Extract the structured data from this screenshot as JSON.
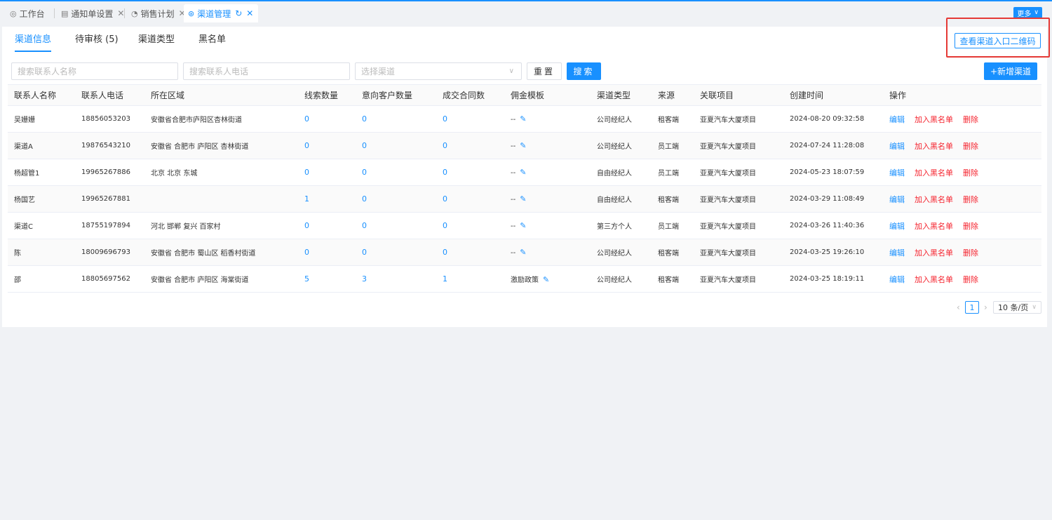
{
  "tabs": [
    {
      "label": "工作台",
      "icon": "dashboard-icon",
      "closable": false,
      "active": false
    },
    {
      "label": "通知单设置",
      "icon": "document-icon",
      "closable": true,
      "active": false
    },
    {
      "label": "销售计划",
      "icon": "chart-icon",
      "closable": true,
      "active": false
    },
    {
      "label": "渠道管理",
      "icon": "channel-icon",
      "closable": true,
      "active": true,
      "refresh": true
    }
  ],
  "more_label": "更多",
  "subtabs": [
    "渠道信息",
    "待审核 (5)",
    "渠道类型",
    "黑名单"
  ],
  "qr_button_label": "查看渠道入口二维码",
  "filters": {
    "name_placeholder": "搜索联系人名称",
    "phone_placeholder": "搜索联系人电话",
    "channel_placeholder": "选择渠道",
    "reset_label": "重置",
    "search_label": "搜索",
    "add_label": "+新增渠道"
  },
  "table": {
    "columns": [
      "联系人名称",
      "联系人电话",
      "所在区域",
      "线索数量",
      "意向客户数量",
      "成交合同数",
      "佣金模板",
      "渠道类型",
      "来源",
      "关联项目",
      "创建时间",
      "操作"
    ],
    "rows": [
      [
        "吴姗姗",
        "18856053203",
        "安徽省合肥市庐阳区杏林街道",
        "0",
        "0",
        "0",
        "--",
        "公司经纪人",
        "租客端",
        "亚夏汽车大厦项目",
        "2024-08-20 09:32:58"
      ],
      [
        "渠道A",
        "19876543210",
        "安徽省 合肥市 庐阳区 杏林街道",
        "0",
        "0",
        "0",
        "--",
        "公司经纪人",
        "员工端",
        "亚夏汽车大厦项目",
        "2024-07-24 11:28:08"
      ],
      [
        "杨超管1",
        "19965267886",
        "北京 北京 东城",
        "0",
        "0",
        "0",
        "--",
        "自由经纪人",
        "员工端",
        "亚夏汽车大厦项目",
        "2024-05-23 18:07:59"
      ],
      [
        "杨国艺",
        "19965267881",
        "",
        "1",
        "0",
        "0",
        "--",
        "自由经纪人",
        "租客端",
        "亚夏汽车大厦项目",
        "2024-03-29 11:08:49"
      ],
      [
        "渠道C",
        "18755197894",
        "河北 邯郸 复兴 百家村",
        "0",
        "0",
        "0",
        "--",
        "第三方个人",
        "员工端",
        "亚夏汽车大厦项目",
        "2024-03-26 11:40:36"
      ],
      [
        "陈",
        "18009696793",
        "安徽省 合肥市 蜀山区 稻香村街道",
        "0",
        "0",
        "0",
        "--",
        "公司经纪人",
        "租客端",
        "亚夏汽车大厦项目",
        "2024-03-25 19:26:10"
      ],
      [
        "邵",
        "18805697562",
        "安徽省 合肥市 庐阳区 海棠街道",
        "5",
        "3",
        "1",
        "激励政策",
        "公司经纪人",
        "租客端",
        "亚夏汽车大厦项目",
        "2024-03-25 18:19:11"
      ]
    ],
    "actions": {
      "edit": "编辑",
      "blacklist": "加入黑名单",
      "delete": "删除"
    }
  },
  "pagination": {
    "prev": "‹",
    "current": "1",
    "next": "›",
    "page_size": "10 条/页"
  },
  "colors": {
    "primary": "#1890ff",
    "danger": "#f5222d",
    "highlight_border": "#e53935"
  }
}
